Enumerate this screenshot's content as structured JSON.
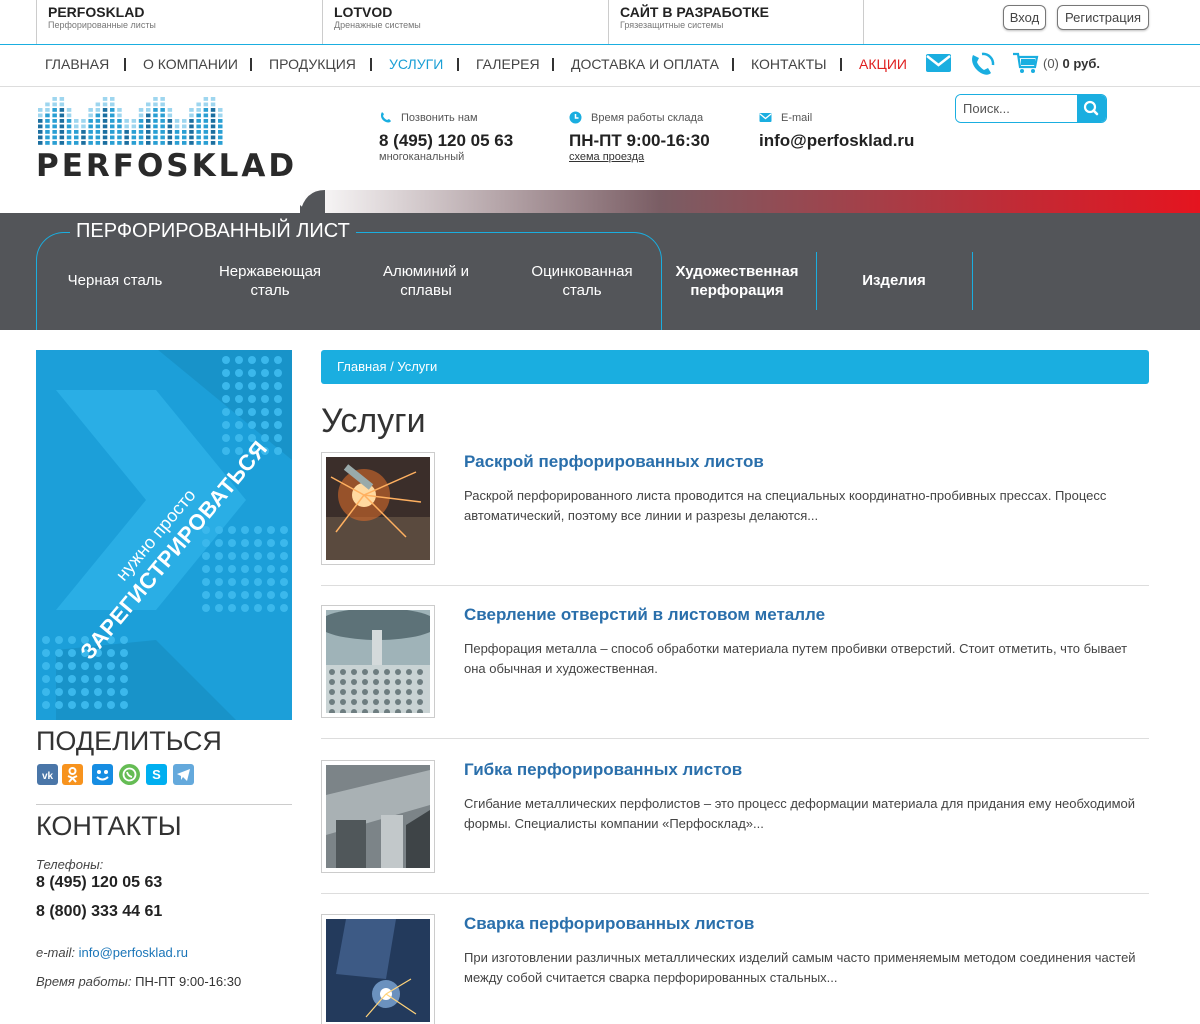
{
  "sites": [
    {
      "title": "PERFOSKLAD",
      "subtitle": "Перфорированные листы"
    },
    {
      "title": "LOTVOD",
      "subtitle": "Дренажные системы"
    },
    {
      "title": "САЙТ В РАЗРАБОТКЕ",
      "subtitle": "Грязезащитные системы"
    }
  ],
  "auth": {
    "login": "Вход",
    "register": "Регистрация"
  },
  "nav": [
    "ГЛАВНАЯ",
    "О КОМПАНИИ",
    "ПРОДУКЦИЯ",
    "УСЛУГИ",
    "ГАЛЕРЕЯ",
    "ДОСТАВКА И ОПЛАТА",
    "КОНТАКТЫ",
    "АКЦИИ"
  ],
  "nav_active": "УСЛУГИ",
  "cart": {
    "count": "(0)",
    "sum": "0 руб."
  },
  "logo_text": "PERFOSKLAD",
  "header": {
    "call_label": "Позвонить нам",
    "phone": "8 (495) 120 05 63",
    "phone_note": "многоканальный",
    "hours_label": "Время работы склада",
    "hours": "ПН-ПТ 9:00-16:30",
    "route": "схема проезда",
    "email_label": "E-mail",
    "email": "info@perfosklad.ru"
  },
  "search": {
    "placeholder": "Поиск..."
  },
  "catalog": {
    "title": "ПЕРФОРИРОВАННЫЙ ЛИСТ",
    "items": [
      "Черная сталь",
      "Нержавеющая сталь",
      "Алюминий и сплавы",
      "Оцинкованная сталь",
      "Художественная перфорация",
      "Изделия"
    ]
  },
  "banner": {
    "line1": "нужно просто",
    "line2": "ЗАРЕГИСТРИРОВАТЬСЯ"
  },
  "share": {
    "title": "ПОДЕЛИТЬСЯ",
    "networks": [
      "vk-icon",
      "odnoklassniki-icon",
      "moimir-icon",
      "whatsapp-icon",
      "skype-icon",
      "telegram-icon"
    ]
  },
  "contacts": {
    "title": "КОНТАКТЫ",
    "phones_label": "Телефоны:",
    "phone1": "8 (495) 120 05 63",
    "phone2": "8 (800) 333 44 61",
    "email_label": "e-mail:",
    "email": "info@perfosklad.ru",
    "hours_label": "Время работы:",
    "hours": "ПН-ПТ 9:00-16:30"
  },
  "breadcrumb": "Главная / Услуги",
  "page_title": "Услуги",
  "services": [
    {
      "title": "Раскрой перфорированных листов",
      "desc": "Раскрой перфорированного листа проводится на специальных координатно-пробивных прессах. Процесс автоматический, поэтому все линии и разрезы делаются..."
    },
    {
      "title": "Сверление отверстий в листовом металле",
      "desc": "Перфорация металла – способ обработки материала путем пробивки отверстий. Стоит отметить, что бывает она обычная и художественная."
    },
    {
      "title": "Гибка перфорированных листов",
      "desc": "Сгибание металлических перфолистов – это процесс деформации материала для придания ему необходимой формы. Специалисты компании «Перфосклад»..."
    },
    {
      "title": "Сварка перфорированных листов",
      "desc": "При изготовлении различных металлических изделий самым часто применяемым методом соединения частей между собой считается сварка перфорированных стальных..."
    }
  ],
  "colors": {
    "accent": "#1aaee0",
    "dark": "#535559",
    "sale": "#e02020",
    "link": "#2a6fab"
  }
}
